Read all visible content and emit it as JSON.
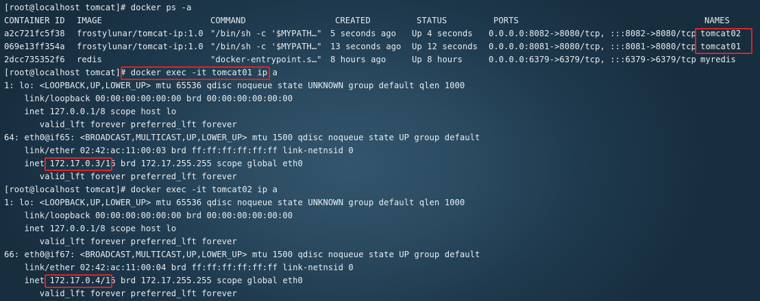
{
  "terminal": {
    "prompt": "[root@localhost tomcat]# ",
    "commands": {
      "ps": "docker ps -a",
      "exec1": "docker exec -it tomcat01 ip a",
      "exec2": "docker exec -it tomcat02 ip a"
    },
    "ps_table": {
      "headers": [
        "CONTAINER ID",
        "IMAGE",
        "COMMAND",
        "CREATED",
        "STATUS",
        "PORTS",
        "NAMES"
      ],
      "rows": [
        [
          "a2c721fc5f38",
          "frostylunar/tomcat-ip:1.0",
          "\"/bin/sh -c '$MYPATH…\"",
          "5 seconds ago",
          "Up 4 seconds",
          "0.0.0.0:8082->8080/tcp, :::8082->8080/tcp",
          "tomcat02"
        ],
        [
          "069e13ff354a",
          "frostylunar/tomcat-ip:1.0",
          "\"/bin/sh -c '$MYPATH…\"",
          "13 seconds ago",
          "Up 12 seconds",
          "0.0.0.0:8081->8080/tcp, :::8081->8080/tcp",
          "tomcat01"
        ],
        [
          "2dcc735352f6",
          "redis",
          "\"docker-entrypoint.s…\"",
          "8 hours ago",
          "Up 8 hours",
          "0.0.0.0:6379->6379/tcp, :::6379->6379/tcp",
          "myredis"
        ]
      ]
    },
    "exec1_output": {
      "lo": "1: lo: <LOOPBACK,UP,LOWER_UP> mtu 65536 qdisc noqueue state UNKNOWN group default qlen 1000",
      "lo_link": "    link/loopback 00:00:00:00:00:00 brd 00:00:00:00:00:00",
      "lo_inet": "    inet 127.0.0.1/8 scope host lo",
      "lo_valid": "       valid_lft forever preferred_lft forever",
      "eth": "64: eth0@if65: <BROADCAST,MULTICAST,UP,LOWER_UP> mtu 1500 qdisc noqueue state UP group default",
      "eth_link": "    link/ether 02:42:ac:11:00:03 brd ff:ff:ff:ff:ff:ff link-netnsid 0",
      "eth_inet_prefix": "    inet ",
      "eth_ip": "172.17.0.3/16",
      "eth_inet_suffix": " brd 172.17.255.255 scope global eth0",
      "eth_valid": "       valid_lft forever preferred_lft forever"
    },
    "exec2_output": {
      "lo": "1: lo: <LOOPBACK,UP,LOWER_UP> mtu 65536 qdisc noqueue state UNKNOWN group default qlen 1000",
      "lo_link": "    link/loopback 00:00:00:00:00:00 brd 00:00:00:00:00:00",
      "lo_inet": "    inet 127.0.0.1/8 scope host lo",
      "lo_valid": "       valid_lft forever preferred_lft forever",
      "eth": "66: eth0@if67: <BROADCAST,MULTICAST,UP,LOWER_UP> mtu 1500 qdisc noqueue state UP group default",
      "eth_link": "    link/ether 02:42:ac:11:00:04 brd ff:ff:ff:ff:ff:ff link-netnsid 0",
      "eth_inet_prefix": "    inet ",
      "eth_ip": "172.17.0.4/16",
      "eth_inet_suffix": " brd 172.17.255.255 scope global eth0",
      "eth_valid": "       valid_lft forever preferred_lft forever"
    },
    "colors": {
      "text": "#e7ecef",
      "highlight": "#d9262c",
      "background": "#2a4a60"
    }
  }
}
